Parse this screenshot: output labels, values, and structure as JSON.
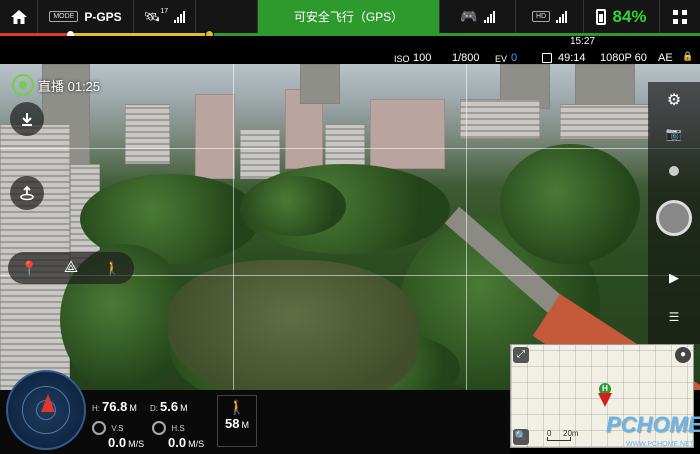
{
  "topbar": {
    "home_icon": "home-icon",
    "mode_badge": "MODE",
    "flight_mode": "P-GPS",
    "satellite_count": "17",
    "status": "可安全飞行（GPS）",
    "battery_percent": "84%"
  },
  "camera": {
    "iso_label": "ISO",
    "iso": "100",
    "shutter": "1/800",
    "ev_label": "EV",
    "ev": "0",
    "record_time": "49:14",
    "resolution": "1080P 60",
    "ae": "AE",
    "clock": "15:27"
  },
  "live": {
    "label": "直播 01:25"
  },
  "telemetry": {
    "h_label": "H:",
    "h_value": "76.8",
    "h_unit": "M",
    "d_label": "D:",
    "d_value": "5.6",
    "d_unit": "M",
    "vs_label": "V.S",
    "vs_value": "0.0",
    "vs_unit": "M/S",
    "hs_label": "H.S",
    "hs_value": "0.0",
    "hs_unit": "M/S",
    "dist_value": "58",
    "dist_unit": "M"
  },
  "minimap": {
    "home_marker": "H",
    "scale_label": "0",
    "scale_value": "20m"
  },
  "watermark": {
    "brand": "PCHOME",
    "url": "WWW.PCHOME.NET"
  },
  "colors": {
    "safe_green": "#2e9a2e",
    "battery_green": "#34d334",
    "warning_red": "#e0362c",
    "ev_blue": "#3fa7ff"
  }
}
